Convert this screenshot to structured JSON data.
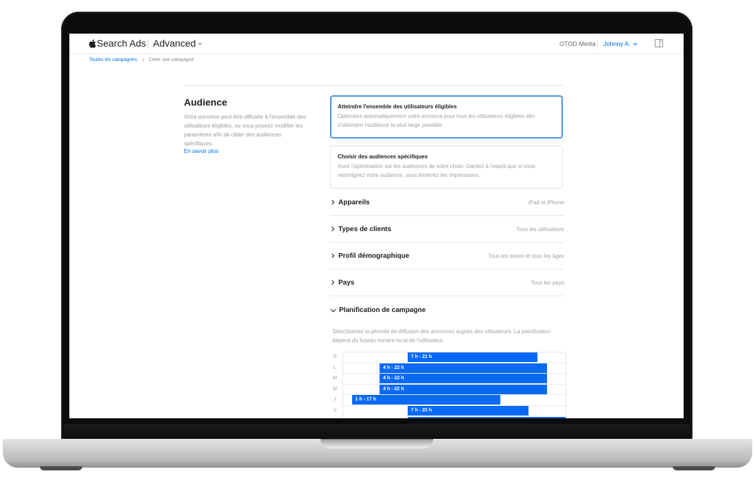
{
  "header": {
    "brand": "Search Ads",
    "product": "Advanced",
    "org": "OTOD Media",
    "user": "Johnny A."
  },
  "breadcrumb": {
    "items": [
      "Toutes les campagnes",
      "Créer une campagne"
    ]
  },
  "audience": {
    "title": "Audience",
    "description": "Votre annonce peut être diffusée à l'ensemble des utilisateurs éligibles, ou vous pouvez modifier les paramètres afin de cibler des audiences spécifiques.",
    "learn_more": "En savoir plus",
    "options": [
      {
        "title": "Atteindre l'ensemble des utilisateurs éligibles",
        "description": "Optimisez automatiquement votre annonce pour tous les utilisateurs éligibles afin d'atteindre l'audience la plus large possible.",
        "selected": true
      },
      {
        "title": "Choisir des audiences spécifiques",
        "description": "Axez l'optimisation sur les audiences de votre choix. Gardez à l'esprit que si vous restreignez votre audience, vous limiterez les impressions.",
        "selected": false
      }
    ],
    "sections": [
      {
        "title": "Appareils",
        "value": "iPad et iPhone"
      },
      {
        "title": "Types de clients",
        "value": "Tous les utilisateurs"
      },
      {
        "title": "Profil démographique",
        "value": "Tous les sexes et tous les âges"
      },
      {
        "title": "Pays",
        "value": "Tous les pays"
      }
    ]
  },
  "schedule": {
    "title": "Planification de campagne",
    "description": "Sélectionnez la période de diffusion des annonces auprès des utilisateurs. La planification dépend du fuseau horaire local de l'utilisateur.",
    "hours_range": [
      0,
      24
    ],
    "days": [
      {
        "label": "D",
        "start": 7,
        "end": 21,
        "text": "7 h - 21 h"
      },
      {
        "label": "L",
        "start": 4,
        "end": 22,
        "text": "4 h - 22 h"
      },
      {
        "label": "M",
        "start": 4,
        "end": 22,
        "text": "4 h - 22 h"
      },
      {
        "label": "M",
        "start": 4,
        "end": 22,
        "text": "4 h - 22 h"
      },
      {
        "label": "J",
        "start": 1,
        "end": 17,
        "text": "1 h - 17 h"
      },
      {
        "label": "V",
        "start": 7,
        "end": 20,
        "text": "7 h - 20 h"
      }
    ]
  },
  "colors": {
    "accent": "#0071e3",
    "bar": "#0a6af5",
    "selected_border": "#4a90e2"
  }
}
